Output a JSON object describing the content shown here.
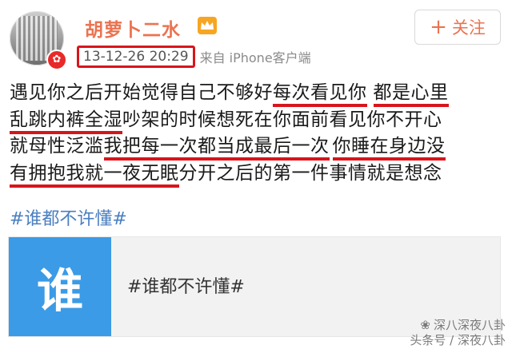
{
  "post": {
    "username": "胡萝卜二水",
    "badge_icon": "crown-icon",
    "timestamp": "13-12-26 20:29",
    "source": "来自 iPhone客户端",
    "follow_label": "关注",
    "follow_icon": "plus-icon",
    "text_lines": [
      [
        "遇见你之后开始觉得自己不够好",
        "每次看见你",
        "都是心里"
      ],
      [
        "乱跳内裤全湿",
        "吵架的时候想死在你面前看见你不开心"
      ],
      [
        "就母性泛滥",
        "我把每一次都当成最后一次",
        "你睡在身边没"
      ],
      [
        "有拥抱我就一夜无眠",
        "分开之后的第一件事情就是想念"
      ]
    ],
    "hashtag": "#谁都不许懂#"
  },
  "card": {
    "thumb_char": "谁",
    "title": "#谁都不许懂#"
  },
  "watermark": {
    "line1": "深八深夜八卦",
    "line2": "头条号 / 深夜八卦"
  },
  "colors": {
    "username": "#eb7350",
    "highlight_underline": "#d8151c",
    "hashtag": "#4a7fc1",
    "card_thumb": "#3b9be6"
  }
}
